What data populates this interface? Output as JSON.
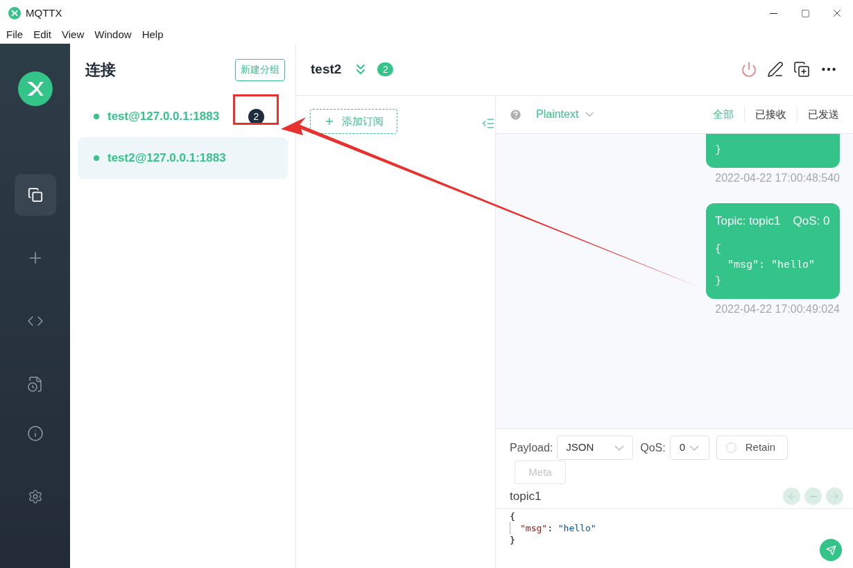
{
  "window": {
    "title": "MQTTX"
  },
  "menu": [
    "File",
    "Edit",
    "View",
    "Window",
    "Help"
  ],
  "nav": [
    {
      "kind": "connections",
      "selected": true
    },
    {
      "kind": "new",
      "selected": false
    },
    {
      "kind": "script",
      "selected": false
    },
    {
      "kind": "log",
      "selected": false
    },
    {
      "kind": "about",
      "selected": false
    },
    {
      "kind": "settings",
      "selected": false
    }
  ],
  "connections_panel": {
    "title": "连接",
    "new_group_button": "新建分组",
    "items": [
      {
        "name": "test@127.0.0.1:1883",
        "unread": "2",
        "selected": false,
        "highlighted": true
      },
      {
        "name": "test2@127.0.0.1:1883",
        "selected": true
      }
    ]
  },
  "header": {
    "title": "test2",
    "badge": "2"
  },
  "subscriptions": {
    "add_button": "添加订阅"
  },
  "messages_toolbar": {
    "format": "Plaintext",
    "filters": [
      {
        "label": "全部",
        "selected": true
      },
      {
        "label": "已接收",
        "selected": false
      },
      {
        "label": "已发送",
        "selected": false
      }
    ]
  },
  "messages": [
    {
      "lines": [
        "}"
      ],
      "time": "2022-04-22 17:00:48:540"
    },
    {
      "topic": "Topic: topic1",
      "qos": "QoS: 0",
      "lines": [
        "{",
        "  \"msg\": \"hello\"",
        "}"
      ],
      "time": "2022-04-22 17:00:49:024"
    }
  ],
  "publish": {
    "payload_label": "Payload:",
    "payload_format": "JSON",
    "qos_label": "QoS:",
    "qos": "0",
    "retain": {
      "label": "Retain",
      "checked": false
    },
    "meta_button": "Meta",
    "topic": "topic1",
    "editor_lines": [
      [
        {
          "text": "{",
          "kind": "punct"
        }
      ],
      [
        {
          "text": "\"msg\"",
          "kind": "key"
        },
        {
          "text": ": ",
          "kind": "punct"
        },
        {
          "text": "\"hello\"",
          "kind": "string"
        }
      ],
      [
        {
          "text": "}",
          "kind": "punct"
        }
      ]
    ]
  }
}
